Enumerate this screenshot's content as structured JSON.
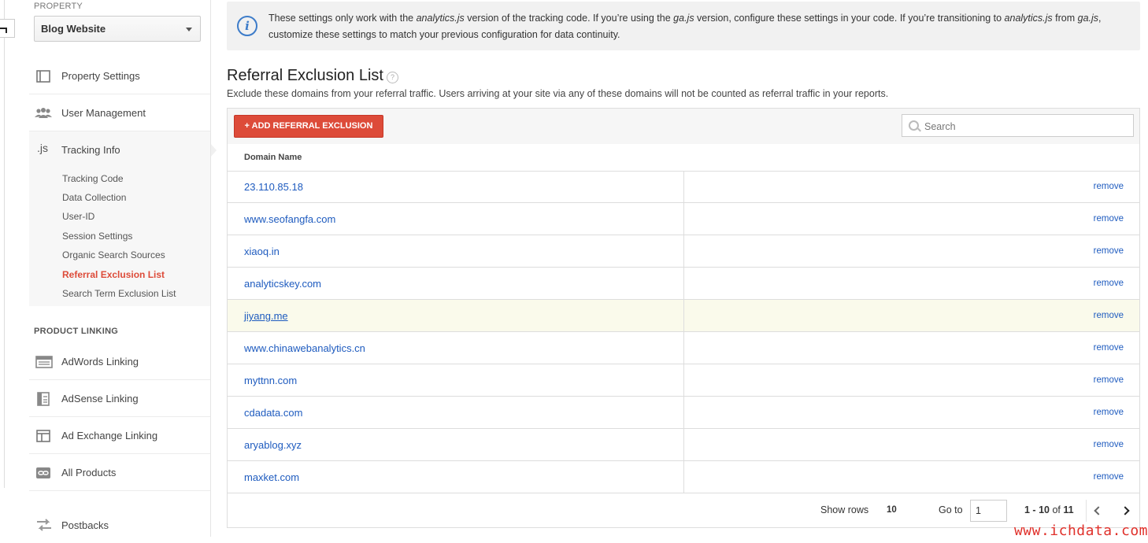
{
  "sidebar": {
    "property_label": "PROPERTY",
    "property_value": "Blog Website",
    "nav": [
      {
        "label": "Property Settings",
        "icon": "property-settings-icon"
      },
      {
        "label": "User Management",
        "icon": "users-icon"
      },
      {
        "label": "Tracking Info",
        "icon": "js-icon",
        "icon_text": ".js"
      }
    ],
    "tracking_sub": [
      {
        "label": "Tracking Code"
      },
      {
        "label": "Data Collection"
      },
      {
        "label": "User-ID"
      },
      {
        "label": "Session Settings"
      },
      {
        "label": "Organic Search Sources"
      },
      {
        "label": "Referral Exclusion List",
        "active": true
      },
      {
        "label": "Search Term Exclusion List"
      }
    ],
    "product_linking_label": "PRODUCT LINKING",
    "linking": [
      {
        "label": "AdWords Linking",
        "icon": "adwords-icon"
      },
      {
        "label": "AdSense Linking",
        "icon": "adsense-icon"
      },
      {
        "label": "Ad Exchange Linking",
        "icon": "ad-exchange-icon"
      },
      {
        "label": "All Products",
        "icon": "link-icon"
      },
      {
        "label": "Postbacks",
        "icon": "postbacks-icon"
      }
    ]
  },
  "banner": {
    "part1": "These settings only work with the ",
    "em1": "analytics.js",
    "part2": " version of the tracking code. If you’re using the ",
    "em2": "ga.js",
    "part3": " version, configure these settings in your code. If you’re transitioning to ",
    "em3": "analytics.js",
    "part4": " from ",
    "em4": "ga.js",
    "part5": ", customize these settings to match your previous configuration for data continuity."
  },
  "page": {
    "title": "Referral Exclusion List",
    "help": "?",
    "description": "Exclude these domains from your referral traffic. Users arriving at your site via any of these domains will not be counted as referral traffic in your reports."
  },
  "table": {
    "add_button": "+ ADD REFERRAL EXCLUSION",
    "search_placeholder": "Search",
    "column_header": "Domain Name",
    "remove_label": "remove",
    "rows": [
      "23.110.85.18",
      "www.seofangfa.com",
      "xiaoq.in",
      "analyticskey.com",
      "jiyang.me",
      "www.chinawebanalytics.cn",
      "myttnn.com",
      "cdadata.com",
      "aryablog.xyz",
      "maxket.com"
    ],
    "highlighted_row": "jiyang.me"
  },
  "pager": {
    "show_rows_label": "Show rows",
    "show_rows_value": "10",
    "goto_label": "Go to",
    "goto_value": "1",
    "range_start": "1",
    "range_end": "10",
    "range_of": "of",
    "total": "11"
  },
  "watermark": "www.ichdata.com",
  "colors": {
    "accent": "#dd4b39",
    "link": "#1e5bbf",
    "info": "#3d7cc9"
  }
}
